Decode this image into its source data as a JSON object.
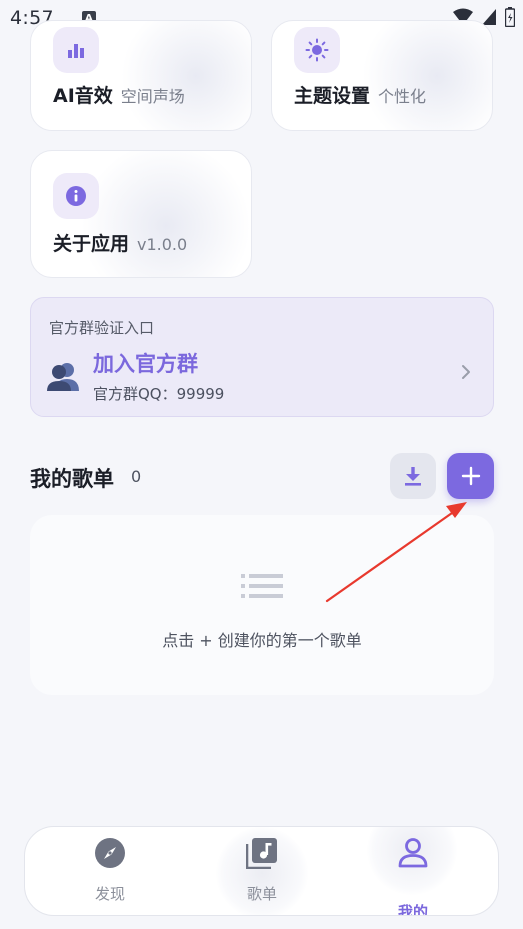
{
  "status_bar": {
    "time": "4:57",
    "notification_badge": "A"
  },
  "features": [
    {
      "title": "AI音效",
      "subtitle": "空间声场",
      "icon": "bar-chart-icon"
    },
    {
      "title": "主题设置",
      "subtitle": "个性化",
      "icon": "sun-icon"
    },
    {
      "title": "关于应用",
      "subtitle": "v1.0.0",
      "icon": "info-icon"
    }
  ],
  "group": {
    "label": "官方群验证入口",
    "join_title": "加入官方群",
    "qq_line": "官方群QQ：99999"
  },
  "playlists": {
    "title": "我的歌单",
    "count": "0",
    "empty_hint": "点击 + 创建你的第一个歌单"
  },
  "bottom_nav": [
    {
      "label": "发现",
      "icon": "compass-icon",
      "active": false
    },
    {
      "label": "歌单",
      "icon": "music-library-icon",
      "active": false
    },
    {
      "label": "我的",
      "icon": "user-icon",
      "active": true
    }
  ],
  "colors": {
    "accent": "#7c69e0",
    "background": "#f5f6fa",
    "annotation_arrow": "#e8392e"
  }
}
